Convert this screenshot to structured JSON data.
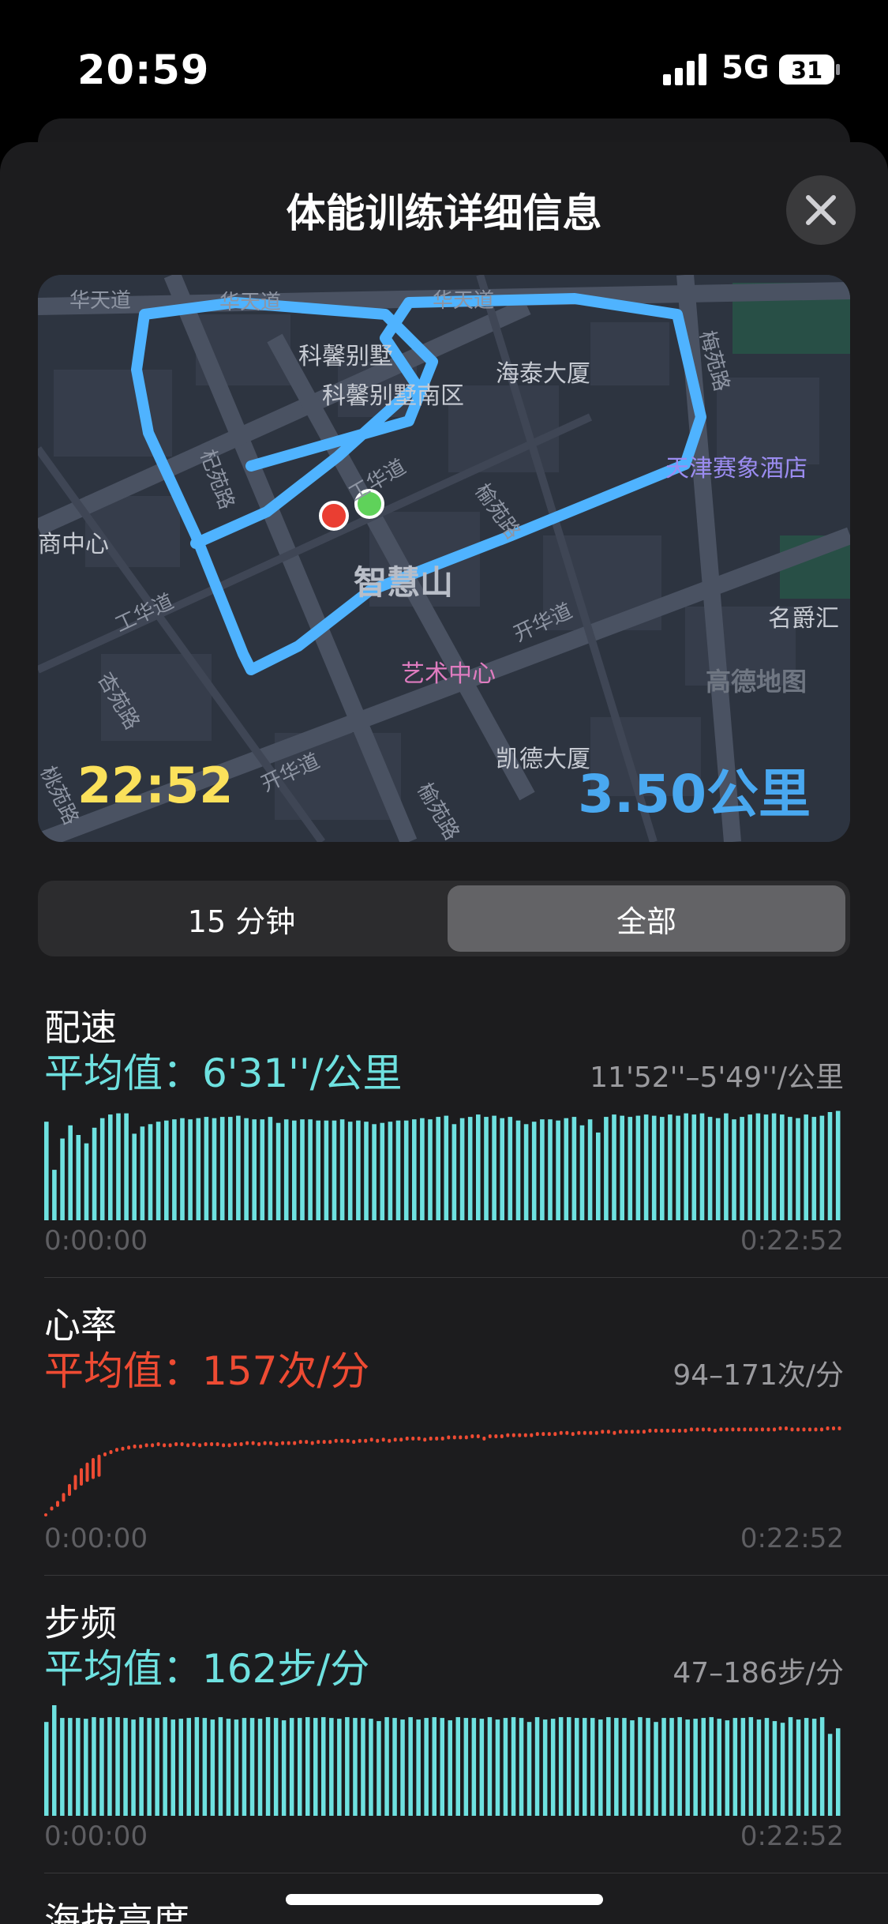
{
  "status_bar": {
    "time": "20:59",
    "network": "5G",
    "battery": "31"
  },
  "sheet": {
    "title": "体能训练详细信息"
  },
  "map": {
    "elapsed": "22:52",
    "distance": "3.50公里",
    "watermark": "高德地图",
    "labels": {
      "kexin_villa": "科馨别墅",
      "kexin_villa_area": "科馨别墅南区",
      "haitai": "海泰大厦",
      "tianjin_hotel": "天津赛象酒店",
      "zhihuishan": "智慧山",
      "art_center": "艺术中心",
      "kaide": "凯德大厦",
      "mingjuehui": "名爵汇",
      "center_left": "商中心",
      "huatian_1": "华天道",
      "huatian_2": "华天道",
      "huatian_3": "华天道",
      "kaihua_1": "开华道",
      "kaihua_2": "开华道",
      "gonghua_1": "工华道",
      "gonghua_2": "工华道",
      "meiyuan": "梅苑路",
      "yuyuan_1": "榆苑路",
      "yuyuan_2": "榆苑路",
      "qiyuan": "杞苑路",
      "xingyuan": "杏苑路",
      "taoyuan": "桃苑路"
    }
  },
  "segmented": {
    "option_a": "15 分钟",
    "option_b": "全部",
    "selected": "全部"
  },
  "metrics": {
    "pace": {
      "name": "配速",
      "avg": "平均值：6'31''/公里",
      "range": "11'52''–5'49''/公里",
      "start": "0:00:00",
      "end": "0:22:52",
      "color": "#6ee1e0"
    },
    "heart": {
      "name": "心率",
      "avg": "平均值：157次/分",
      "range": "94–171次/分",
      "start": "0:00:00",
      "end": "0:22:52",
      "color": "#ee4b33"
    },
    "cadence": {
      "name": "步频",
      "avg": "平均值：162步/分",
      "range": "47–186步/分",
      "start": "0:00:00",
      "end": "0:22:52",
      "color": "#6ee1e0"
    },
    "altitude": {
      "name": "海拔高度"
    }
  },
  "chart_data": [
    {
      "type": "bar",
      "title": "配速",
      "x_range": [
        "0:00:00",
        "0:22:52"
      ],
      "ylabel": "",
      "values": [
        8.2,
        4.2,
        6.8,
        7.9,
        7.1,
        6.4,
        7.7,
        8.5,
        8.8,
        8.9,
        8.9,
        7.2,
        7.8,
        8.0,
        8.2,
        8.3,
        8.4,
        8.5,
        8.4,
        8.5,
        8.6,
        8.5,
        8.6,
        8.6,
        8.7,
        8.5,
        8.4,
        8.4,
        8.6,
        8.1,
        8.4,
        8.3,
        8.4,
        8.4,
        8.3,
        8.3,
        8.3,
        8.4,
        8.2,
        8.3,
        8.2,
        8.0,
        8.1,
        8.2,
        8.3,
        8.3,
        8.4,
        8.5,
        8.4,
        8.6,
        8.7,
        8.0,
        8.5,
        8.6,
        8.8,
        8.6,
        8.7,
        8.5,
        8.6,
        8.3,
        8.0,
        8.2,
        8.4,
        8.4,
        8.3,
        8.5,
        8.6,
        7.9,
        8.4,
        7.3,
        8.6,
        8.8,
        8.7,
        8.6,
        8.7,
        8.8,
        8.7,
        8.6,
        8.8,
        8.7,
        8.9,
        8.8,
        8.9,
        8.6,
        8.5,
        8.9,
        8.4,
        8.6,
        8.8,
        8.9,
        8.8,
        8.9,
        8.8,
        8.6,
        8.5,
        8.8,
        8.6,
        8.7,
        9.0,
        9.1
      ]
    },
    {
      "type": "scatter",
      "title": "心率",
      "x_range": [
        "0:00:00",
        "0:22:52"
      ],
      "ylim": [
        94,
        171
      ],
      "values": [
        94,
        100,
        105,
        112,
        120,
        128,
        134,
        139,
        143,
        146,
        148,
        150,
        152,
        153,
        154,
        155,
        155,
        156,
        156,
        157,
        156,
        156,
        157,
        157,
        156,
        157,
        156,
        157,
        157,
        157,
        156,
        156,
        157,
        157,
        158,
        158,
        157,
        158,
        158,
        157,
        158,
        158,
        158,
        159,
        159,
        158,
        159,
        159,
        159,
        160,
        160,
        160,
        159,
        160,
        160,
        161,
        160,
        161,
        160,
        161,
        161,
        162,
        162,
        162,
        161,
        162,
        162,
        162,
        163,
        163,
        163,
        163,
        164,
        164,
        162,
        164,
        164,
        164,
        165,
        165,
        165,
        165,
        165,
        166,
        166,
        166,
        166,
        167,
        167,
        166,
        167,
        167,
        167,
        167,
        168,
        168,
        167,
        168,
        168,
        168,
        168,
        168,
        169,
        169,
        169,
        169,
        169,
        169,
        169,
        170,
        170,
        170,
        170,
        169,
        170,
        170,
        170,
        170,
        170,
        170,
        170,
        170,
        170,
        170,
        171,
        171,
        170,
        170,
        170,
        170,
        170,
        170,
        171,
        171,
        171
      ]
    },
    {
      "type": "bar",
      "title": "步频",
      "x_range": [
        "0:00:00",
        "0:22:52"
      ],
      "ylim": [
        47,
        186
      ],
      "values": [
        165,
        186,
        170,
        170,
        170,
        169,
        171,
        170,
        171,
        171,
        170,
        168,
        171,
        170,
        170,
        171,
        168,
        169,
        170,
        171,
        170,
        168,
        171,
        169,
        168,
        170,
        170,
        169,
        171,
        170,
        167,
        170,
        170,
        171,
        170,
        171,
        170,
        169,
        171,
        170,
        170,
        169,
        166,
        171,
        170,
        168,
        171,
        168,
        170,
        171,
        170,
        167,
        171,
        170,
        170,
        169,
        171,
        168,
        170,
        171,
        170,
        165,
        171,
        168,
        169,
        171,
        171,
        170,
        170,
        170,
        168,
        171,
        170,
        170,
        167,
        171,
        170,
        165,
        170,
        170,
        171,
        168,
        169,
        170,
        171,
        169,
        167,
        170,
        170,
        171,
        168,
        170,
        166,
        164,
        171,
        168,
        170,
        169,
        171,
        150,
        157
      ]
    }
  ]
}
